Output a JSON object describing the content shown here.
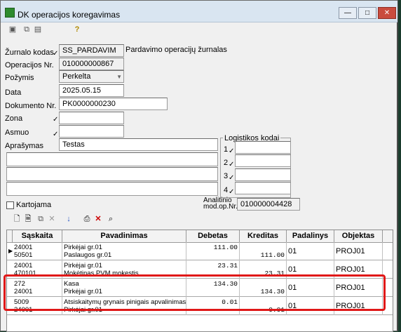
{
  "window": {
    "title": "DK operacijos koregavimas",
    "minimize": "—",
    "maximize": "□",
    "close": "✕"
  },
  "toolbar": {
    "icons": [
      "save-icon",
      "copy-icon",
      "paste-icon",
      "help-icon"
    ]
  },
  "form": {
    "zurnalo_kodas_label": "Žurnalo kodas",
    "zurnalo_kodas_value": "SS_PARDAVIM",
    "zurnalo_kodas_desc": "Pardavimo operacijų žurnalas",
    "operacijos_nr_label": "Operacijos Nr.",
    "operacijos_nr_value": "010000000867",
    "pozymis_label": "Požymis",
    "pozymis_value": "Perkelta",
    "data_label": "Data",
    "data_value": "2025.05.15",
    "dokumento_nr_label": "Dokumento Nr.",
    "dokumento_nr_value": "PK0000000230",
    "zona_label": "Zona",
    "zona_value": "",
    "asmuo_label": "Asmuo",
    "asmuo_value": "",
    "aprasymas_label": "Aprašymas",
    "aprasymas_value": "Testas",
    "logistikos_title": "Logistikos kodai",
    "log_labels": [
      "1",
      "2",
      "3",
      "4"
    ],
    "kartojama_label": "Kartojama",
    "analitinio_label_1": "Analitinio",
    "analitinio_label_2": "mod.op.Nr.",
    "analitinio_value": "010000004428"
  },
  "grid": {
    "columns": [
      "Sąskaita",
      "Pavadinimas",
      "Debetas",
      "Kreditas",
      "Padalinys",
      "Objektas"
    ],
    "rows": [
      {
        "acc1": "24001",
        "acc2": "50501",
        "name1": "Pirkėjai gr.01",
        "name2": "Paslaugos gr.01",
        "debet": "111.00",
        "kredit": "111.00",
        "padalinys": "01",
        "objektas": "PROJ01"
      },
      {
        "acc1": "24001",
        "acc2": "470101",
        "name1": "Pirkėjai gr.01",
        "name2": "Mokėtinas PVM mokestis",
        "debet": "23.31",
        "kredit": "23.31",
        "padalinys": "01",
        "objektas": "PROJ01"
      },
      {
        "acc1": "272",
        "acc2": "24001",
        "name1": "Kasa",
        "name2": "Pirkėjai gr.01",
        "debet": "134.30",
        "kredit": "134.30",
        "padalinys": "01",
        "objektas": "PROJ01"
      },
      {
        "acc1": "5009",
        "acc2": "24001",
        "name1": "Atsiskaitymų grynais pinigais apvalinimas (+/-",
        "name2": "Pirkėjai gr.01",
        "debet": "0.01",
        "kredit": "0.01",
        "padalinys": "01",
        "objektas": "PROJ01"
      }
    ]
  },
  "colors": {
    "highlight": "#e01818",
    "titlebar": "#d9e5f1"
  }
}
